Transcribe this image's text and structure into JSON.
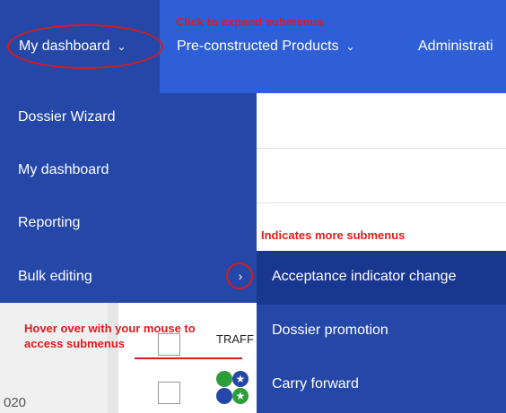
{
  "topnav": {
    "items": [
      {
        "label": "My dashboard"
      },
      {
        "label": "Pre-constructed Products"
      },
      {
        "label": "Administrati"
      }
    ]
  },
  "dropdown": {
    "items": [
      {
        "label": "Dossier Wizard"
      },
      {
        "label": "My dashboard"
      },
      {
        "label": "Reporting"
      },
      {
        "label": "Bulk editing"
      }
    ]
  },
  "submenu": {
    "items": [
      {
        "label": "Acceptance indicator change"
      },
      {
        "label": "Dossier promotion"
      },
      {
        "label": "Carry forward"
      }
    ]
  },
  "table": {
    "traffic_header": "TRAFF",
    "year_fragment": "020"
  },
  "annotations": {
    "expand": "Click to expand submenus",
    "more": "Indicates more submenus",
    "hover": "Hover over with your mouse to access submenus"
  },
  "colors": {
    "nav_blue": "#2e5fd6",
    "menu_blue": "#2447a8",
    "annotation_red": "#e01b1b"
  }
}
